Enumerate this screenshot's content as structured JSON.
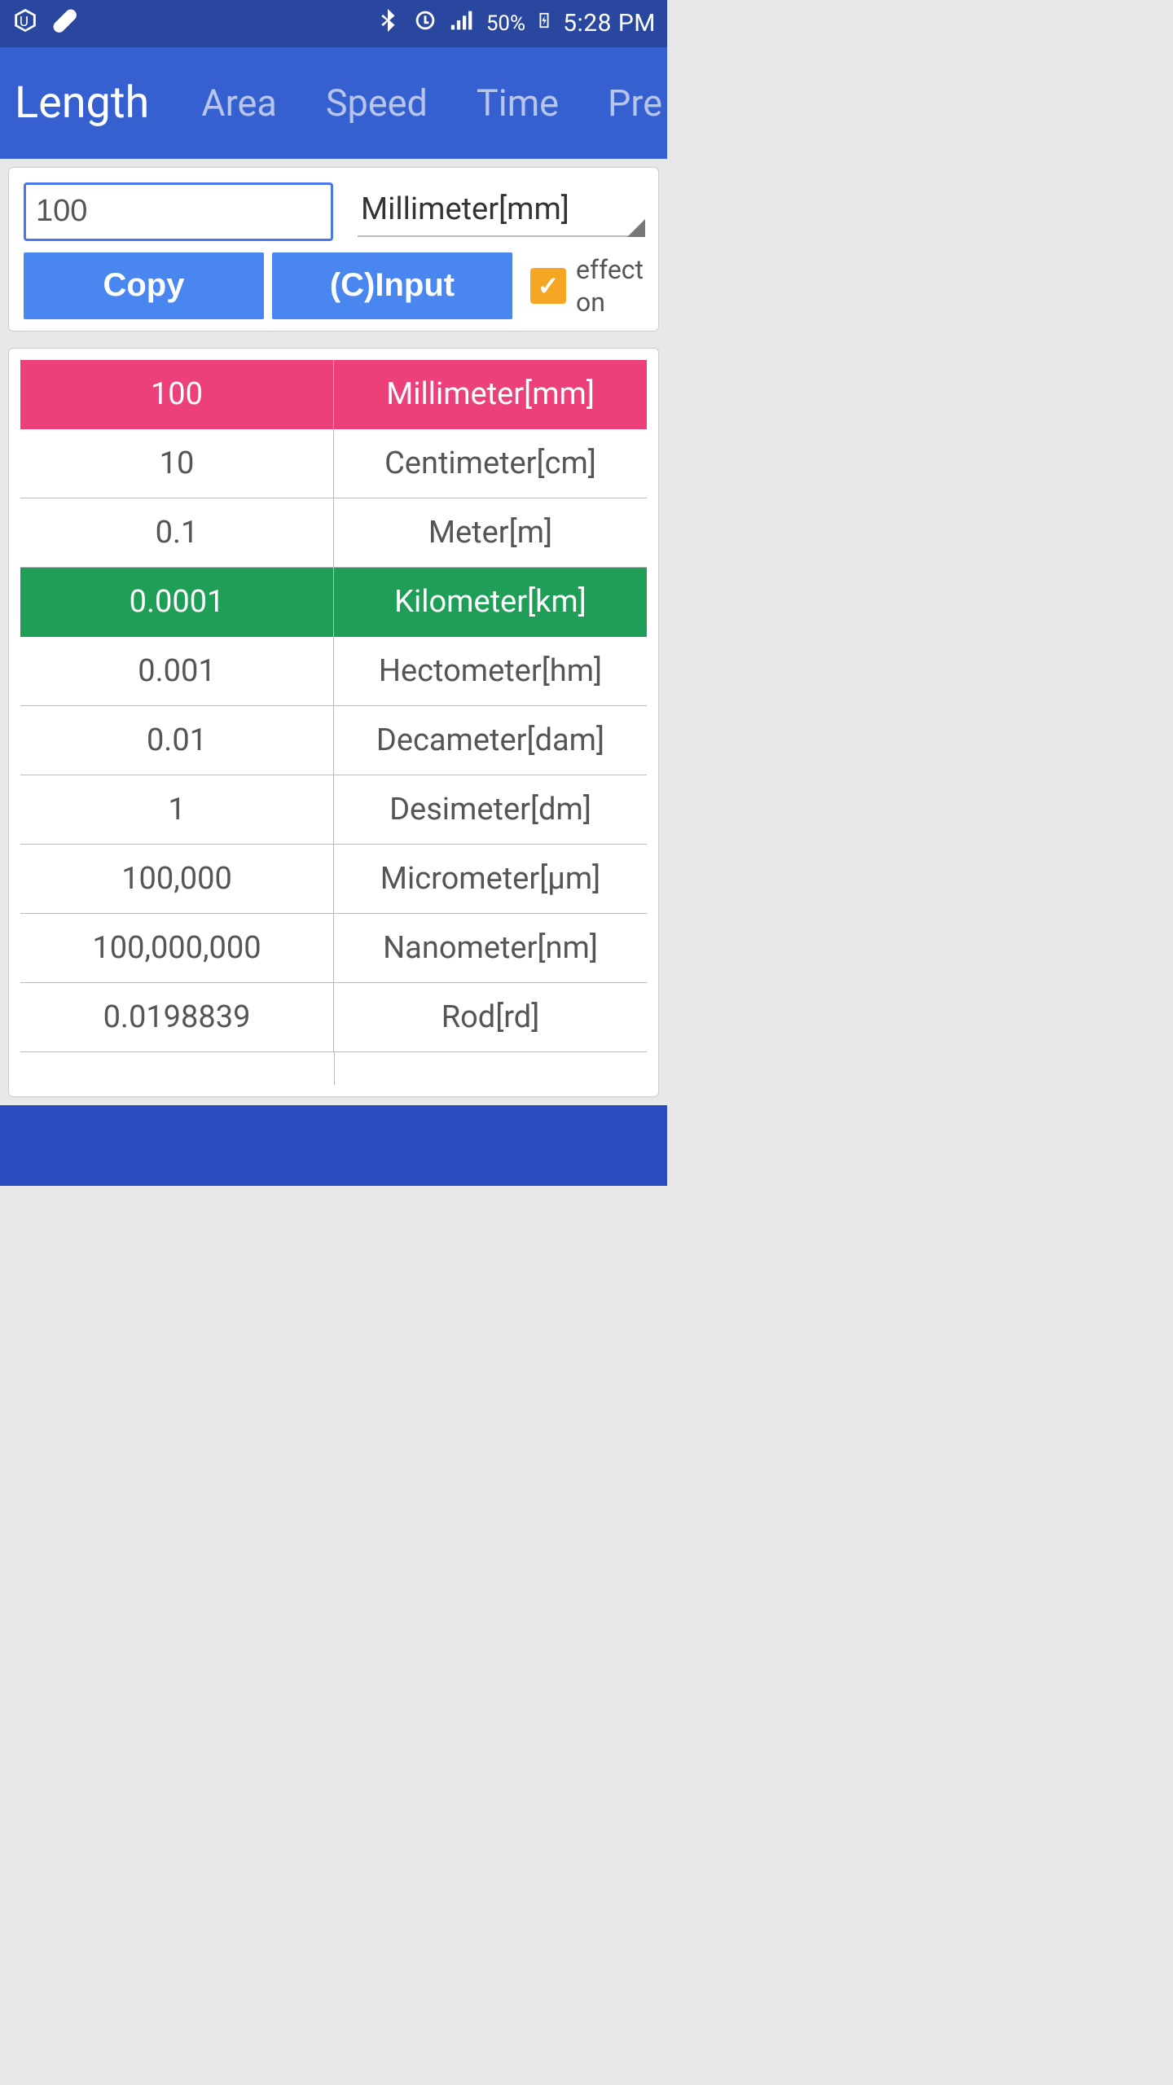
{
  "status": {
    "battery_pct": "50%",
    "time": "5:28 PM"
  },
  "tabs": {
    "items": [
      "Length",
      "Area",
      "Speed",
      "Time",
      "Pre"
    ],
    "active_index": 0
  },
  "input": {
    "value": "100",
    "unit_selected": "Millimeter[mm]",
    "copy_label": "Copy",
    "cinput_label": "(C)Input",
    "effect_label_line1": "effect",
    "effect_label_line2": "on",
    "effect_checked": true
  },
  "results": {
    "rows": [
      {
        "value": "100",
        "unit": "Millimeter[mm]",
        "style": "pink"
      },
      {
        "value": "10",
        "unit": "Centimeter[cm]",
        "style": ""
      },
      {
        "value": "0.1",
        "unit": "Meter[m]",
        "style": ""
      },
      {
        "value": "0.0001",
        "unit": "Kilometer[km]",
        "style": "green"
      },
      {
        "value": "0.001",
        "unit": "Hectometer[hm]",
        "style": ""
      },
      {
        "value": "0.01",
        "unit": "Decameter[dam]",
        "style": ""
      },
      {
        "value": "1",
        "unit": "Desimeter[dm]",
        "style": ""
      },
      {
        "value": "100,000",
        "unit": "Micrometer[µm]",
        "style": ""
      },
      {
        "value": "100,000,000",
        "unit": "Nanometer[nm]",
        "style": ""
      },
      {
        "value": "0.0198839",
        "unit": "Rod[rd]",
        "style": ""
      }
    ]
  }
}
